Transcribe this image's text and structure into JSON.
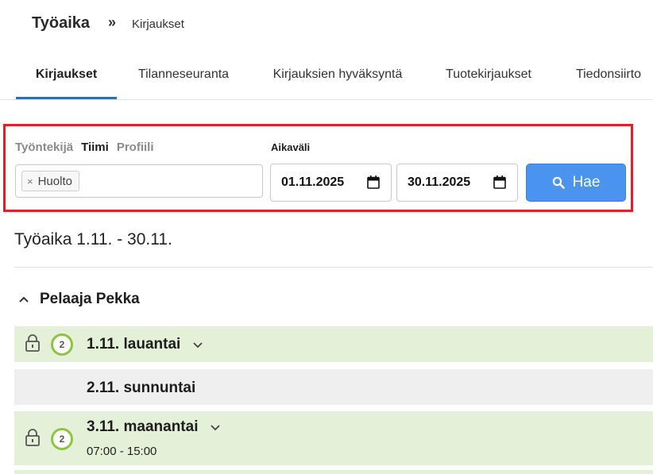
{
  "header": {
    "title": "Työaika",
    "separator": "»",
    "breadcrumb": "Kirjaukset"
  },
  "tabs": [
    {
      "label": "Kirjaukset",
      "active": true
    },
    {
      "label": "Tilanneseuranta",
      "active": false
    },
    {
      "label": "Kirjauksien hyväksyntä",
      "active": false
    },
    {
      "label": "Tuotekirjaukset",
      "active": false
    },
    {
      "label": "Tiedonsiirto",
      "active": false
    }
  ],
  "filter": {
    "type_tabs": [
      {
        "label": "Työntekijä",
        "active": false
      },
      {
        "label": "Tiimi",
        "active": true
      },
      {
        "label": "Profiili",
        "active": false
      }
    ],
    "selected_tag": "Huolto",
    "tag_remove": "×",
    "range_label": "Aikaväli",
    "start_date": "01.11.2025",
    "end_date": "30.11.2025",
    "search_label": "Hae"
  },
  "period_title": "Työaika 1.11. - 30.11.",
  "person": {
    "name": "Pelaaja Pekka",
    "days": [
      {
        "label": "1.11. lauantai",
        "badge": "2",
        "locked": true,
        "time": ""
      },
      {
        "label": "2.11. sunnuntai",
        "badge": "",
        "locked": false,
        "time": ""
      },
      {
        "label": "3.11. maanantai",
        "badge": "2",
        "locked": true,
        "time": "07:00 - 15:00"
      }
    ]
  },
  "colors": {
    "accent": "#2f6fb1",
    "button": "#4a93ee",
    "highlight_border": "#e0202a",
    "approved_row": "#e4f0d8",
    "neutral_row": "#efefef",
    "badge_ring": "#8dc441"
  }
}
